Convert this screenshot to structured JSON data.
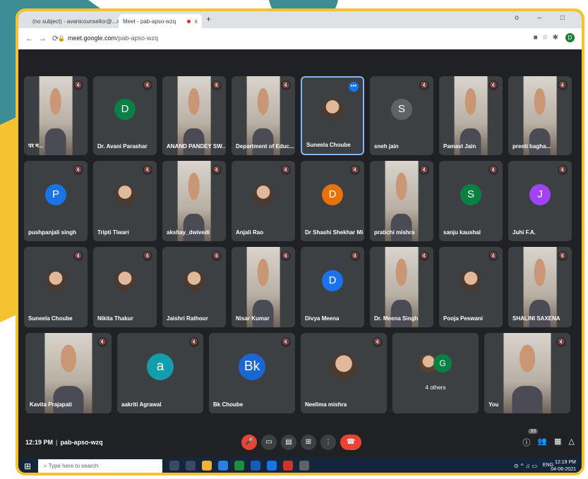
{
  "browser": {
    "tabs": [
      {
        "title": "(no subject) - avanicounsellor@...",
        "close": "x"
      },
      {
        "title": "Meet - pab-apso-wzq",
        "close": "x"
      }
    ],
    "new_tab": "+",
    "window_controls": "o – □",
    "url": {
      "host": "meet.google.com",
      "path": "/pab-apso-wzq"
    },
    "profile_initial": "D"
  },
  "participants": [
    {
      "name": "पर म...",
      "kind": "video"
    },
    {
      "name": "Dr. Avani Parashar",
      "kind": "letter",
      "initial": "D",
      "color": "#0b8043"
    },
    {
      "name": "ANAND PANDEY SW...",
      "kind": "video"
    },
    {
      "name": "Department of Educ...",
      "kind": "video"
    },
    {
      "name": "Suneela Choube",
      "kind": "photo",
      "active": true
    },
    {
      "name": "sneh jain",
      "kind": "letter",
      "initial": "S",
      "color": "#5f6368"
    },
    {
      "name": "Pamavi Jain",
      "kind": "video"
    },
    {
      "name": "preeti bagha...",
      "kind": "video"
    },
    {
      "name": "pushpanjali singh",
      "kind": "letter",
      "initial": "P",
      "color": "#1a73e8"
    },
    {
      "name": "Tripti Tiwari",
      "kind": "photo"
    },
    {
      "name": "akshay_dwivedi",
      "kind": "video"
    },
    {
      "name": "Anjali Rao",
      "kind": "photo"
    },
    {
      "name": "Dr Shashi Shekhar Mis...",
      "kind": "letter",
      "initial": "D",
      "color": "#e8710a"
    },
    {
      "name": "pratichi mishra",
      "kind": "video"
    },
    {
      "name": "sanju kaushal",
      "kind": "letter",
      "initial": "S",
      "color": "#0b8043"
    },
    {
      "name": "Juhi F.A.",
      "kind": "letter",
      "initial": "J",
      "color": "#a142f4"
    },
    {
      "name": "Suneela Choube",
      "kind": "photo"
    },
    {
      "name": "Nikita Thakur",
      "kind": "photo"
    },
    {
      "name": "Jaishri Rathour",
      "kind": "photo"
    },
    {
      "name": "Nisar Kumar",
      "kind": "video"
    },
    {
      "name": "Divya Meena",
      "kind": "letter",
      "initial": "D",
      "color": "#1a73e8"
    },
    {
      "name": "Dr. Meena Singh",
      "kind": "video"
    },
    {
      "name": "Pooja Peswani",
      "kind": "photo"
    },
    {
      "name": "SHALINI SAXENA",
      "kind": "video"
    },
    {
      "name": "Kavita Prajapati",
      "kind": "video"
    },
    {
      "name": "aakriti Agrawal",
      "kind": "letter",
      "initial": "a",
      "color": "#129eaf"
    },
    {
      "name": "Bk Choube",
      "kind": "letter",
      "initial": "Bk",
      "color": "#1967d2"
    },
    {
      "name": "Neelima mishra",
      "kind": "photo"
    },
    {
      "name": "4 others",
      "kind": "others",
      "initial": "G"
    },
    {
      "name": "You",
      "kind": "video"
    }
  ],
  "controls": {
    "time": "12:19 PM",
    "meeting_code": "pab-apso-wzq",
    "participant_count": "33"
  },
  "taskbar": {
    "search_placeholder": "Type here to search",
    "language": "ENG",
    "time": "12:19 PM",
    "date": "04-06-2021"
  },
  "colors": {
    "frame": "#f6c232",
    "accent": "#3c8d96",
    "meet_bg": "#202124",
    "tile": "#3c4043"
  }
}
